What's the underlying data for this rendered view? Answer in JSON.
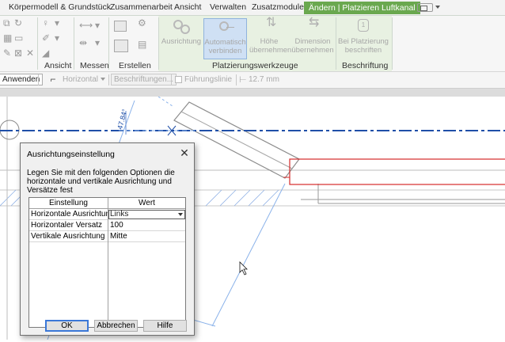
{
  "ribbon": {
    "tabs": [
      "Körpermodell & Grundstück",
      "Zusammenarbeit",
      "Ansicht",
      "Verwalten",
      "Zusatzmodule"
    ],
    "active_tab": "Ändern | Platzieren Luftkanal",
    "panels": {
      "ansicht": "Ansicht",
      "messen": "Messen",
      "erstellen": "Erstellen",
      "platzierungswerkzeuge": "Platzierungswerkzeuge",
      "beschriftung": "Beschriftung"
    },
    "tools": {
      "ausrichtung": "Ausrichtung",
      "auto_line1": "Automatisch",
      "auto_line2": "verbinden",
      "hoehe_line1": "Höhe",
      "hoehe_line2": "übernehmen",
      "dim_line1": "Dimension",
      "dim_line2": "übernehmen",
      "tag_line1": "Bei Platzierung",
      "tag_line2": "beschriften",
      "tag_icon_glyph": "1"
    }
  },
  "options_bar": {
    "apply_label": "Anwenden",
    "orientation_value": "Horizontal",
    "labels_button": "Beschriftungen...",
    "leader_label": "Führungslinie",
    "leader_checked": false,
    "leader_length": "12.7 mm"
  },
  "canvas": {
    "dimension_text": "47.84°"
  },
  "dialog": {
    "title": "Ausrichtungseinstellung",
    "close_glyph": "✕",
    "description": "Legen Sie mit den folgenden Optionen die horizontale und vertikale Ausrichtung und Versätze fest",
    "columns": [
      "Einstellung",
      "Wert"
    ],
    "rows": [
      {
        "setting": "Horizontale Ausrichtun",
        "value": "Links"
      },
      {
        "setting": "Horizontaler Versatz",
        "value": "100"
      },
      {
        "setting": "Vertikale Ausrichtung",
        "value": "Mitte"
      }
    ],
    "buttons": {
      "ok": "OK",
      "cancel": "Abbrechen",
      "help": "Hilfe"
    }
  },
  "colors": {
    "active_tab": "#6aa84f",
    "context_panel": "#e8f1e2",
    "selection_line": "#1f4fa8",
    "duct_outline": "#d42a2a",
    "construction_line": "#8ab2ea"
  }
}
